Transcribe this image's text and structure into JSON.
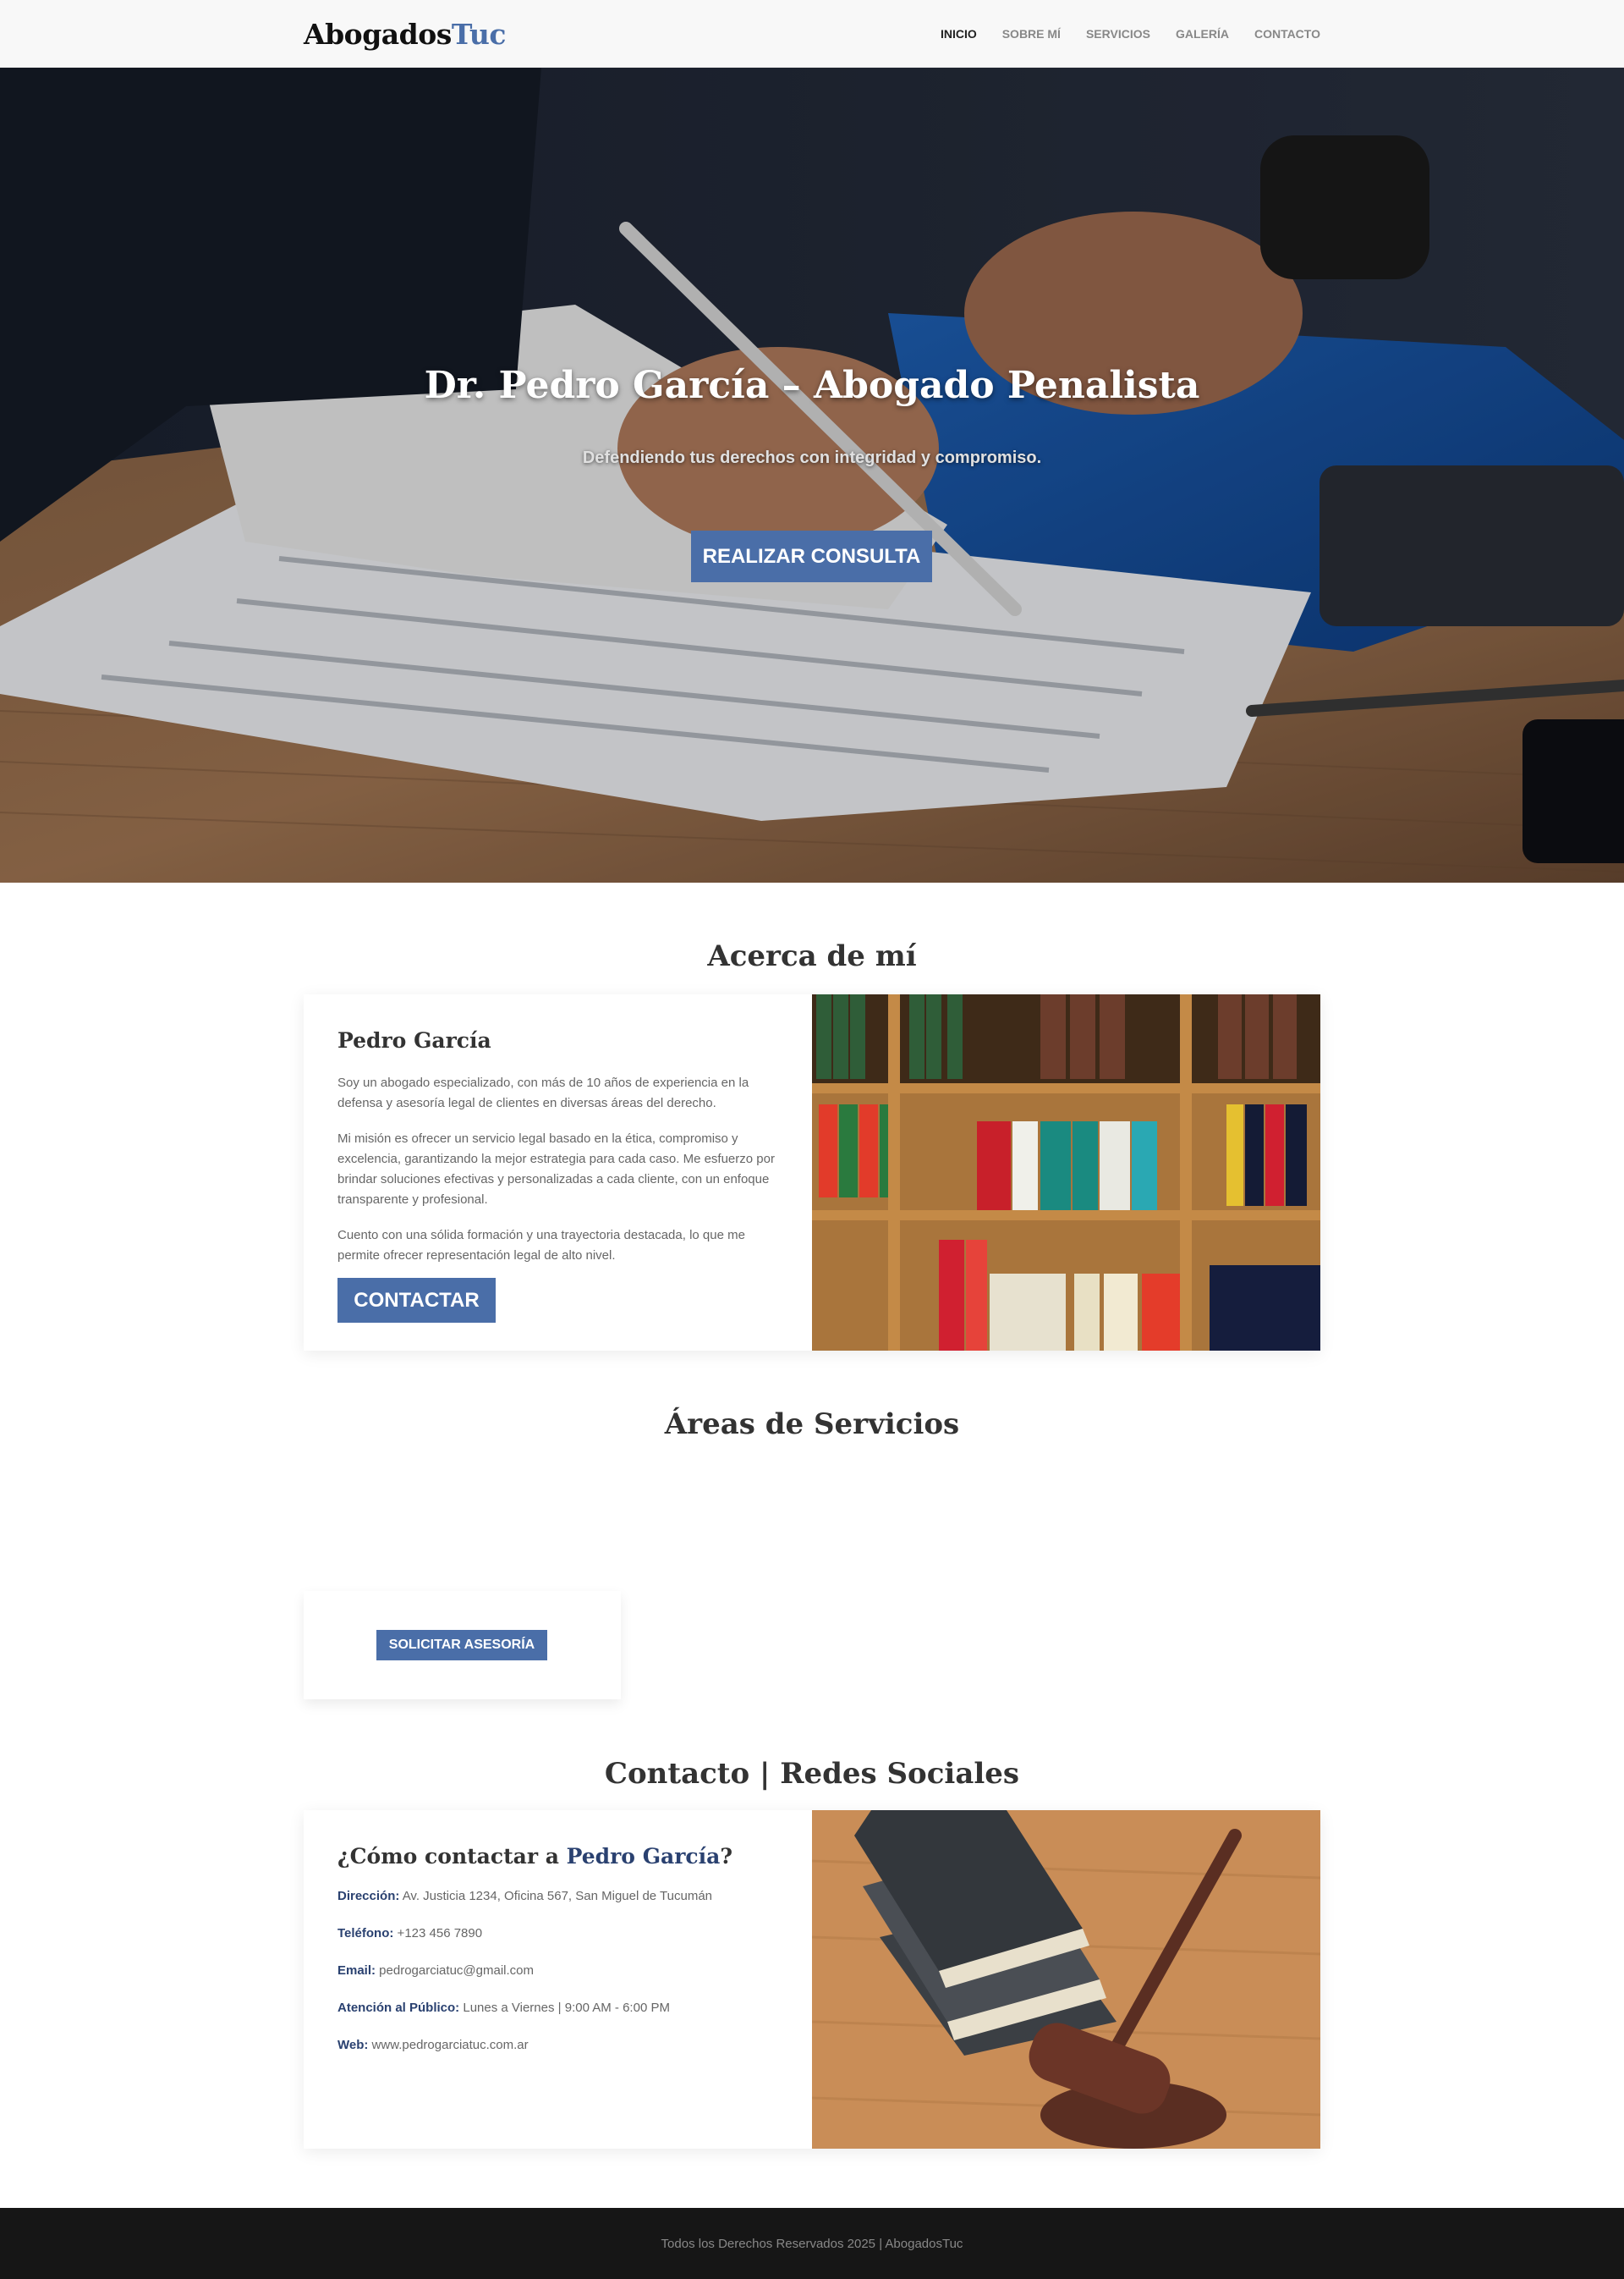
{
  "nav": {
    "brand_main": "Abogados",
    "brand_accent": "Tuc",
    "links": [
      "INICIO",
      "SOBRE MÍ",
      "SERVICIOS",
      "GALERÍA",
      "CONTACTO"
    ]
  },
  "hero": {
    "title": "Dr. Pedro García – Abogado Penalista",
    "subtitle": "Defendiendo tus derechos con integridad y compromiso.",
    "button": "REALIZAR CONSULTA"
  },
  "about": {
    "section_title": "Acerca de mí",
    "name": "Pedro García",
    "paragraphs": [
      "Soy un abogado especializado, con más de 10 años de experiencia en la defensa y asesoría legal de clientes en diversas áreas del derecho.",
      "Mi misión es ofrecer un servicio legal basado en la ética, compromiso y excelencia, garantizando la mejor estrategia para cada caso. Me esfuerzo por brindar soluciones efectivas y personalizadas a cada cliente, con un enfoque transparente y profesional.",
      "Cuento con una sólida formación y una trayectoria destacada, lo que me permite ofrecer representación legal de alto nivel."
    ],
    "button": "CONTACTAR"
  },
  "services": {
    "section_title": "Áreas de Servicios",
    "button": "SOLICITAR ASESORÍA"
  },
  "contact": {
    "section_title": "Contacto | Redes Sociales",
    "heading_prefix": "¿Cómo contactar a ",
    "heading_name": "Pedro García",
    "heading_suffix": "?",
    "items": [
      {
        "label": "Dirección:",
        "value": " Av. Justicia 1234, Oficina 567, San Miguel de Tucumán"
      },
      {
        "label": "Teléfono:",
        "value": " +123 456 7890"
      },
      {
        "label": "Email:",
        "value": " pedrogarciatuc@gmail.com"
      },
      {
        "label": "Atención al Público:",
        "value": " Lunes a Viernes | 9:00 AM - 6:00 PM"
      },
      {
        "label": "Web:",
        "value": " www.pedrogarciatuc.com.ar"
      }
    ]
  },
  "footer": {
    "text": "Todos los Derechos Reservados 2025 | AbogadosTuc"
  },
  "colors": {
    "accent": "#4a6ea8",
    "dark_accent": "#2a4170",
    "footer_bg": "#161616"
  }
}
